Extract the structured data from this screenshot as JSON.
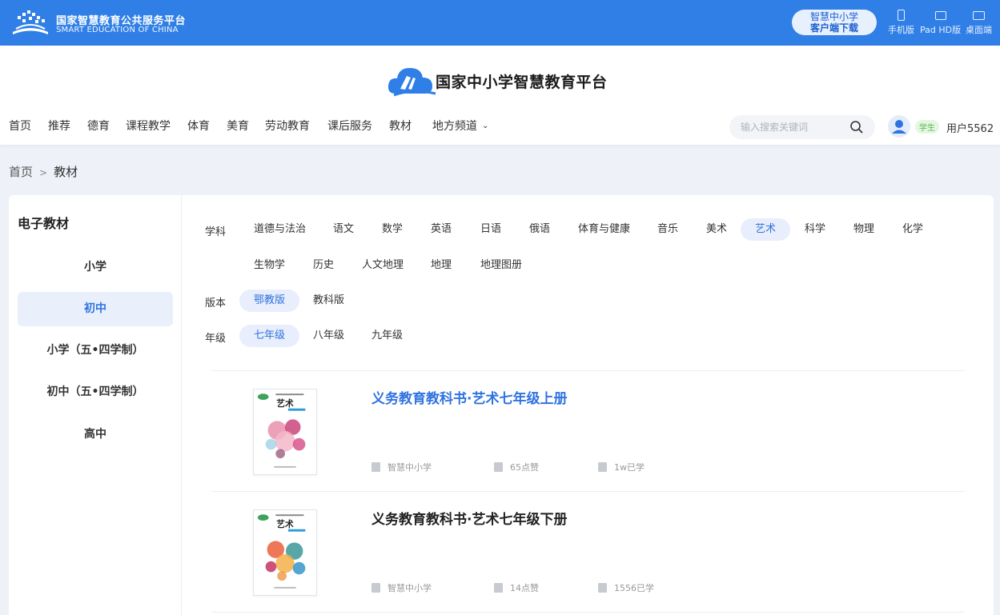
{
  "topbar": {
    "site_name": "国家智慧教育公共服务平台",
    "site_name_en": "SMART EDUCATION OF CHINA",
    "download_line1": "智慧中小学",
    "download_line2": "客户端下载",
    "devices": [
      "手机版",
      "Pad HD版",
      "桌面端"
    ]
  },
  "header": {
    "brand": "国家中小学智慧教育平台",
    "nav": [
      "首页",
      "推荐",
      "德育",
      "课程教学",
      "体育",
      "美育",
      "劳动教育",
      "课后服务",
      "教材",
      "地方频道"
    ],
    "search_placeholder": "输入搜索关键词",
    "role": "学生",
    "username": "用户5562"
  },
  "breadcrumb": {
    "home": "首页",
    "sep": ">",
    "current": "教材"
  },
  "sidebar": {
    "title": "电子教材",
    "items": [
      "小学",
      "初中",
      "小学（五•四学制）",
      "初中（五•四学制）",
      "高中"
    ],
    "active_index": 1
  },
  "filters": {
    "subject_label": "学科",
    "subjects_row1": [
      "道德与法治",
      "语文",
      "数学",
      "英语",
      "日语",
      "俄语",
      "体育与健康",
      "音乐",
      "美术",
      "艺术",
      "科学",
      "物理",
      "化学"
    ],
    "subjects_row2": [
      "生物学",
      "历史",
      "人文地理",
      "地理",
      "地理图册"
    ],
    "selected_subject": "艺术",
    "edition_label": "版本",
    "editions": [
      "鄂教版",
      "教科版"
    ],
    "selected_edition": "鄂教版",
    "grade_label": "年级",
    "grades": [
      "七年级",
      "八年级",
      "九年级"
    ],
    "selected_grade": "七年级"
  },
  "books": [
    {
      "title": "义务教育教科书·艺术七年级上册",
      "publisher": "智慧中小学",
      "likes": "65点赞",
      "learners": "1w已学",
      "highlighted": true,
      "cover_title": "艺术"
    },
    {
      "title": "义务教育教科书·艺术七年级下册",
      "publisher": "智慧中小学",
      "likes": "14点赞",
      "learners": "1556已学",
      "highlighted": false,
      "cover_title": "艺术"
    }
  ],
  "colors": {
    "primary": "#2f7fe6",
    "accent": "#2f73e0",
    "selected_bg": "#e8eefb"
  }
}
